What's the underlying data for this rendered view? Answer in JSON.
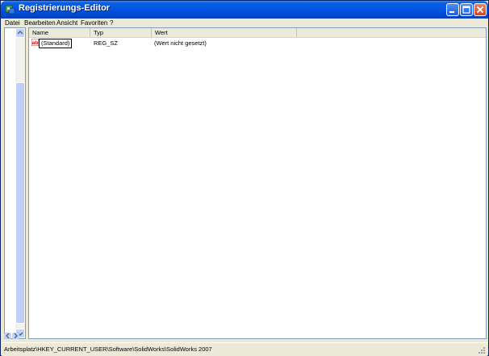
{
  "window": {
    "title": "Registrierungs-Editor",
    "icon": "regedit-icon"
  },
  "menu": {
    "items": [
      {
        "label": "Datei"
      },
      {
        "label": "Bearbeiten"
      },
      {
        "label": "Ansicht"
      },
      {
        "label": "Favoriten"
      },
      {
        "label": "?"
      }
    ]
  },
  "list": {
    "columns": [
      {
        "label": "Name"
      },
      {
        "label": "Typ"
      },
      {
        "label": "Wert"
      }
    ],
    "rows": [
      {
        "name": "(Standard)",
        "type": "REG_SZ",
        "value": "(Wert nicht gesetzt)",
        "icon": "string-value-icon"
      }
    ]
  },
  "status": {
    "path": "Arbeitsplatz\\HKEY_CURRENT_USER\\Software\\SolidWorks\\SolidWorks 2007"
  },
  "colors": {
    "titlebar": "#0054e3",
    "close_button": "#c74a22",
    "window_bg": "#ece9d8"
  }
}
